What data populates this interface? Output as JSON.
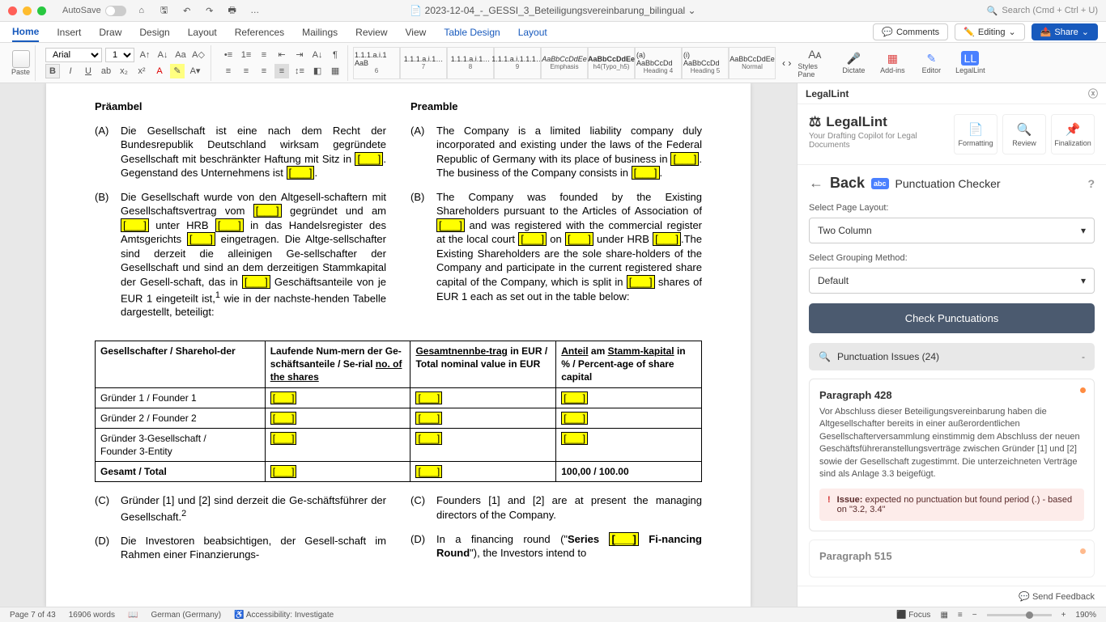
{
  "titlebar": {
    "autosave": "AutoSave",
    "doc": "2023-12-04_-_GESSI_3_Beteiligungsvereinbarung_bilingual",
    "search": "Search (Cmd + Ctrl + U)"
  },
  "qat": [
    "⌂",
    "🖫",
    "↶",
    "↷",
    "🖶",
    "…"
  ],
  "tabs": [
    "Home",
    "Insert",
    "Draw",
    "Design",
    "Layout",
    "References",
    "Mailings",
    "Review",
    "View",
    "Table Design",
    "Layout"
  ],
  "tabs_right": {
    "comments": "Comments",
    "editing": "Editing",
    "share": "Share"
  },
  "ribbon": {
    "paste": "Paste",
    "font": "Arial",
    "size": "10",
    "styles": [
      {
        "preview": "1.1.1.a.i.1 AaB",
        "name": "6"
      },
      {
        "preview": "1.1.1.a.i.1…",
        "name": "7"
      },
      {
        "preview": "1.1.1.a.i.1…",
        "name": "8"
      },
      {
        "preview": "1.1.1.a.i.1.1.1…",
        "name": "9"
      },
      {
        "preview": "AaBbCcDdEe",
        "name": "Emphasis"
      },
      {
        "preview": "AaBbCcDdEe",
        "name": "h4(Typo_h5)"
      },
      {
        "preview": "(a) AaBbCcDd",
        "name": "Heading 4"
      },
      {
        "preview": "(i) AaBbCcDd",
        "name": "Heading 5"
      },
      {
        "preview": "AaBbCcDdEe",
        "name": "Normal"
      }
    ],
    "right": [
      "Styles Pane",
      "Dictate",
      "Add-ins",
      "Editor",
      "LegalLint"
    ]
  },
  "doc": {
    "left_h": "Präambel",
    "right_h": "Preamble",
    "A_de_pre": "Die Gesellschaft ist eine nach dem Recht der Bundesrepublik Deutschland wirksam gegründete Gesellschaft mit beschränkter Haftung mit Sitz in ",
    "A_de_mid": ". Gegenstand des Unternehmens ist ",
    "A_de_end": ".",
    "A_en_pre": "The Company is a limited liability company duly incorporated and existing under the laws of the Federal Republic of Germany with its place of business in ",
    "A_en_mid": ". The business of the Company consists in ",
    "A_en_end": ".",
    "B_de_1": "Die Gesellschaft wurde von den Altgesell-schaftern mit Gesellschaftsvertrag vom ",
    "B_de_2": " gegründet und am ",
    "B_de_3": " unter HRB ",
    "B_de_4": " in das Handelsregister des Amtsgerichts ",
    "B_de_5": " eingetragen. Die Altge-sellschafter sind derzeit die alleinigen Ge-sellschafter der Gesellschaft und sind an dem derzeitigen Stammkapital der Gesell-schaft, das in ",
    "B_de_6": " Geschäftsanteile von je EUR 1 eingeteilt ist,",
    "B_de_7": " wie in der nachste-henden Tabelle dargestellt, beteiligt:",
    "B_en_1": "The Company was founded by the Existing Shareholders pursuant to the Articles of Association of ",
    "B_en_2": " and was registered with the commercial register at the local court ",
    "B_en_3": " on ",
    "B_en_4": " under HRB ",
    "B_en_5": ".The Existing Shareholders are the sole share-holders of the Company and participate in the current registered share capital of the Company, which is split in ",
    "B_en_6": " shares of EUR 1 each as set out in the table below:",
    "th1": "Gesellschafter / Sharehol-der",
    "th2a": "Laufende Num-mern der Ge-schäftsanteile / Se-rial ",
    "th2b": "no. of the shares",
    "th3a": "Gesamtnennbe-trag",
    "th3b": " in EUR / Total nominal value in EUR",
    "th4a": "Anteil",
    "th4b": " am ",
    "th4c": "Stamm-kapital",
    "th4d": " in % / Percent-age of share capital",
    "r1": "Gründer 1 / Founder 1",
    "r2": "Gründer 2 / Founder 2",
    "r3a": "Gründer 3-Gesellschaft     /",
    "r3b": "Founder 3-Entity",
    "r4": "Gesamt / Total",
    "r4v": "100,00 / 100.00",
    "C_de": "Gründer [1] und [2] sind derzeit die Ge-schäftsführer der Gesellschaft.",
    "C_en": "Founders [1] and [2] are at present the managing directors of the Company.",
    "D_de": "Die Investoren beabsichtigen, der Gesell-schaft im Rahmen einer Finanzierungs-",
    "D_en_1": "In a financing round (\"",
    "D_en_2": "Series ",
    "D_en_3": " Fi-nancing Round",
    "D_en_4": "\"), the Investors intend to",
    "blank": "[___]",
    "sup1": "1",
    "sup2": "2"
  },
  "pane": {
    "title": "LegalLint",
    "brand": "LegalLint",
    "tag": "Your Drafting Copilot for Legal Documents",
    "btn_fmt": "Formatting",
    "btn_rev": "Review",
    "btn_fin": "Finalization",
    "back": "Back",
    "section": "Punctuation Checker",
    "lbl1": "Select Page Layout:",
    "sel1": "Two Column",
    "lbl2": "Select Grouping Method:",
    "sel2": "Default",
    "primary": "Check Punctuations",
    "acc": "Punctuation Issues (24)",
    "card1_h": "Paragraph 428",
    "card1_p": "Vor Abschluss dieser Beteiligungsvereinbarung haben die Altgesellschafter bereits in einer außerordentlichen Gesellschafterversammlung einstimmig dem Abschluss der neuen Geschäftsführeranstellungsverträge zwischen Gründer [1] und [2] sowie der Gesellschaft zugestimmt. Die unterzeichneten Verträge sind als Anlage 3.3 beigefügt.",
    "issue_l": "Issue:",
    "issue_t": " expected no punctuation but found period (.) - based on \"3.2, 3.4\"",
    "card2_h": "Paragraph 515",
    "feedback": "Send Feedback"
  },
  "status": {
    "page": "Page 7 of 43",
    "words": "16906 words",
    "lang": "German (Germany)",
    "acc": "Accessibility: Investigate",
    "focus": "Focus",
    "zoom": "190%"
  }
}
